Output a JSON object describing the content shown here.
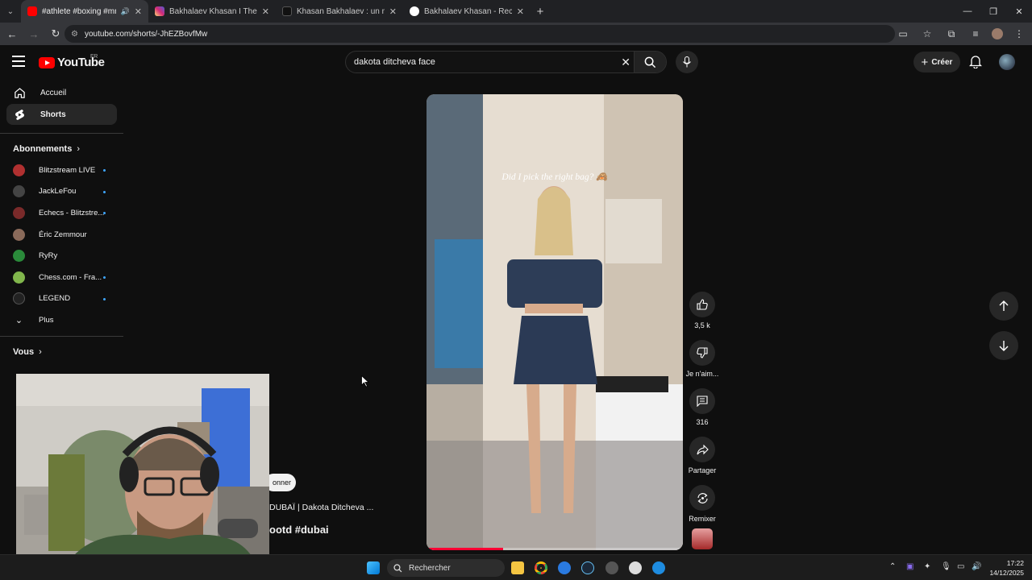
{
  "browser": {
    "tabs": [
      {
        "title": "#athlete #boxing #mma #c",
        "active": true,
        "favicon_color": "#ff0000"
      },
      {
        "title": "Bakhalaev Khasan I The Ghost I",
        "active": false,
        "favicon_color": "#d62976"
      },
      {
        "title": "Khasan Bakhalaev : un moment",
        "active": false,
        "favicon_color": "#000000"
      },
      {
        "title": "Bakhalaev Khasan - Recherche G",
        "active": false,
        "favicon_color": "#4285f4"
      }
    ],
    "url": "youtube.com/shorts/-JhEZBovfMw"
  },
  "youtube": {
    "logo_text": "YouTube",
    "country": "FR",
    "search_value": "dakota ditcheva face",
    "create_label": "Créer"
  },
  "sidebar": {
    "items": [
      {
        "label": "Accueil",
        "icon": "home-icon"
      },
      {
        "label": "Shorts",
        "icon": "shorts-icon"
      }
    ],
    "subscriptions_title": "Abonnements",
    "subscriptions": [
      {
        "name": "Blitzstream LIVE",
        "dot": true,
        "color": "#b03030"
      },
      {
        "name": "JackLeFou",
        "dot": true,
        "color": "#444444"
      },
      {
        "name": "Echecs - Blitzstre...",
        "dot": true,
        "color": "#7a2a2a"
      },
      {
        "name": "Éric Zemmour",
        "dot": false,
        "color": "#8a6a5a"
      },
      {
        "name": "RyRy",
        "dot": false,
        "color": "#2a8a3a"
      },
      {
        "name": "Chess.com - Fra...",
        "dot": true,
        "color": "#81b64c"
      },
      {
        "name": "LEGEND",
        "dot": true,
        "color": "#222222"
      }
    ],
    "more_label": "Plus",
    "you_title": "Vous"
  },
  "video": {
    "caption": "Did I pick the right bag? 🙈",
    "progress": 0.3
  },
  "actions": {
    "likes": "3,5 k",
    "dislike_label": "Je n'aim...",
    "comments": "316",
    "share_label": "Partager",
    "remix_label": "Remixer"
  },
  "meta": {
    "subscribe_partial": "onner",
    "title_partial": "DUBAÏ | Dakota Ditcheva ...",
    "hashtags_partial": "ootd #dubai"
  },
  "taskbar": {
    "search_label": "Rechercher",
    "time": "17:22",
    "date": "14/12/2025"
  }
}
